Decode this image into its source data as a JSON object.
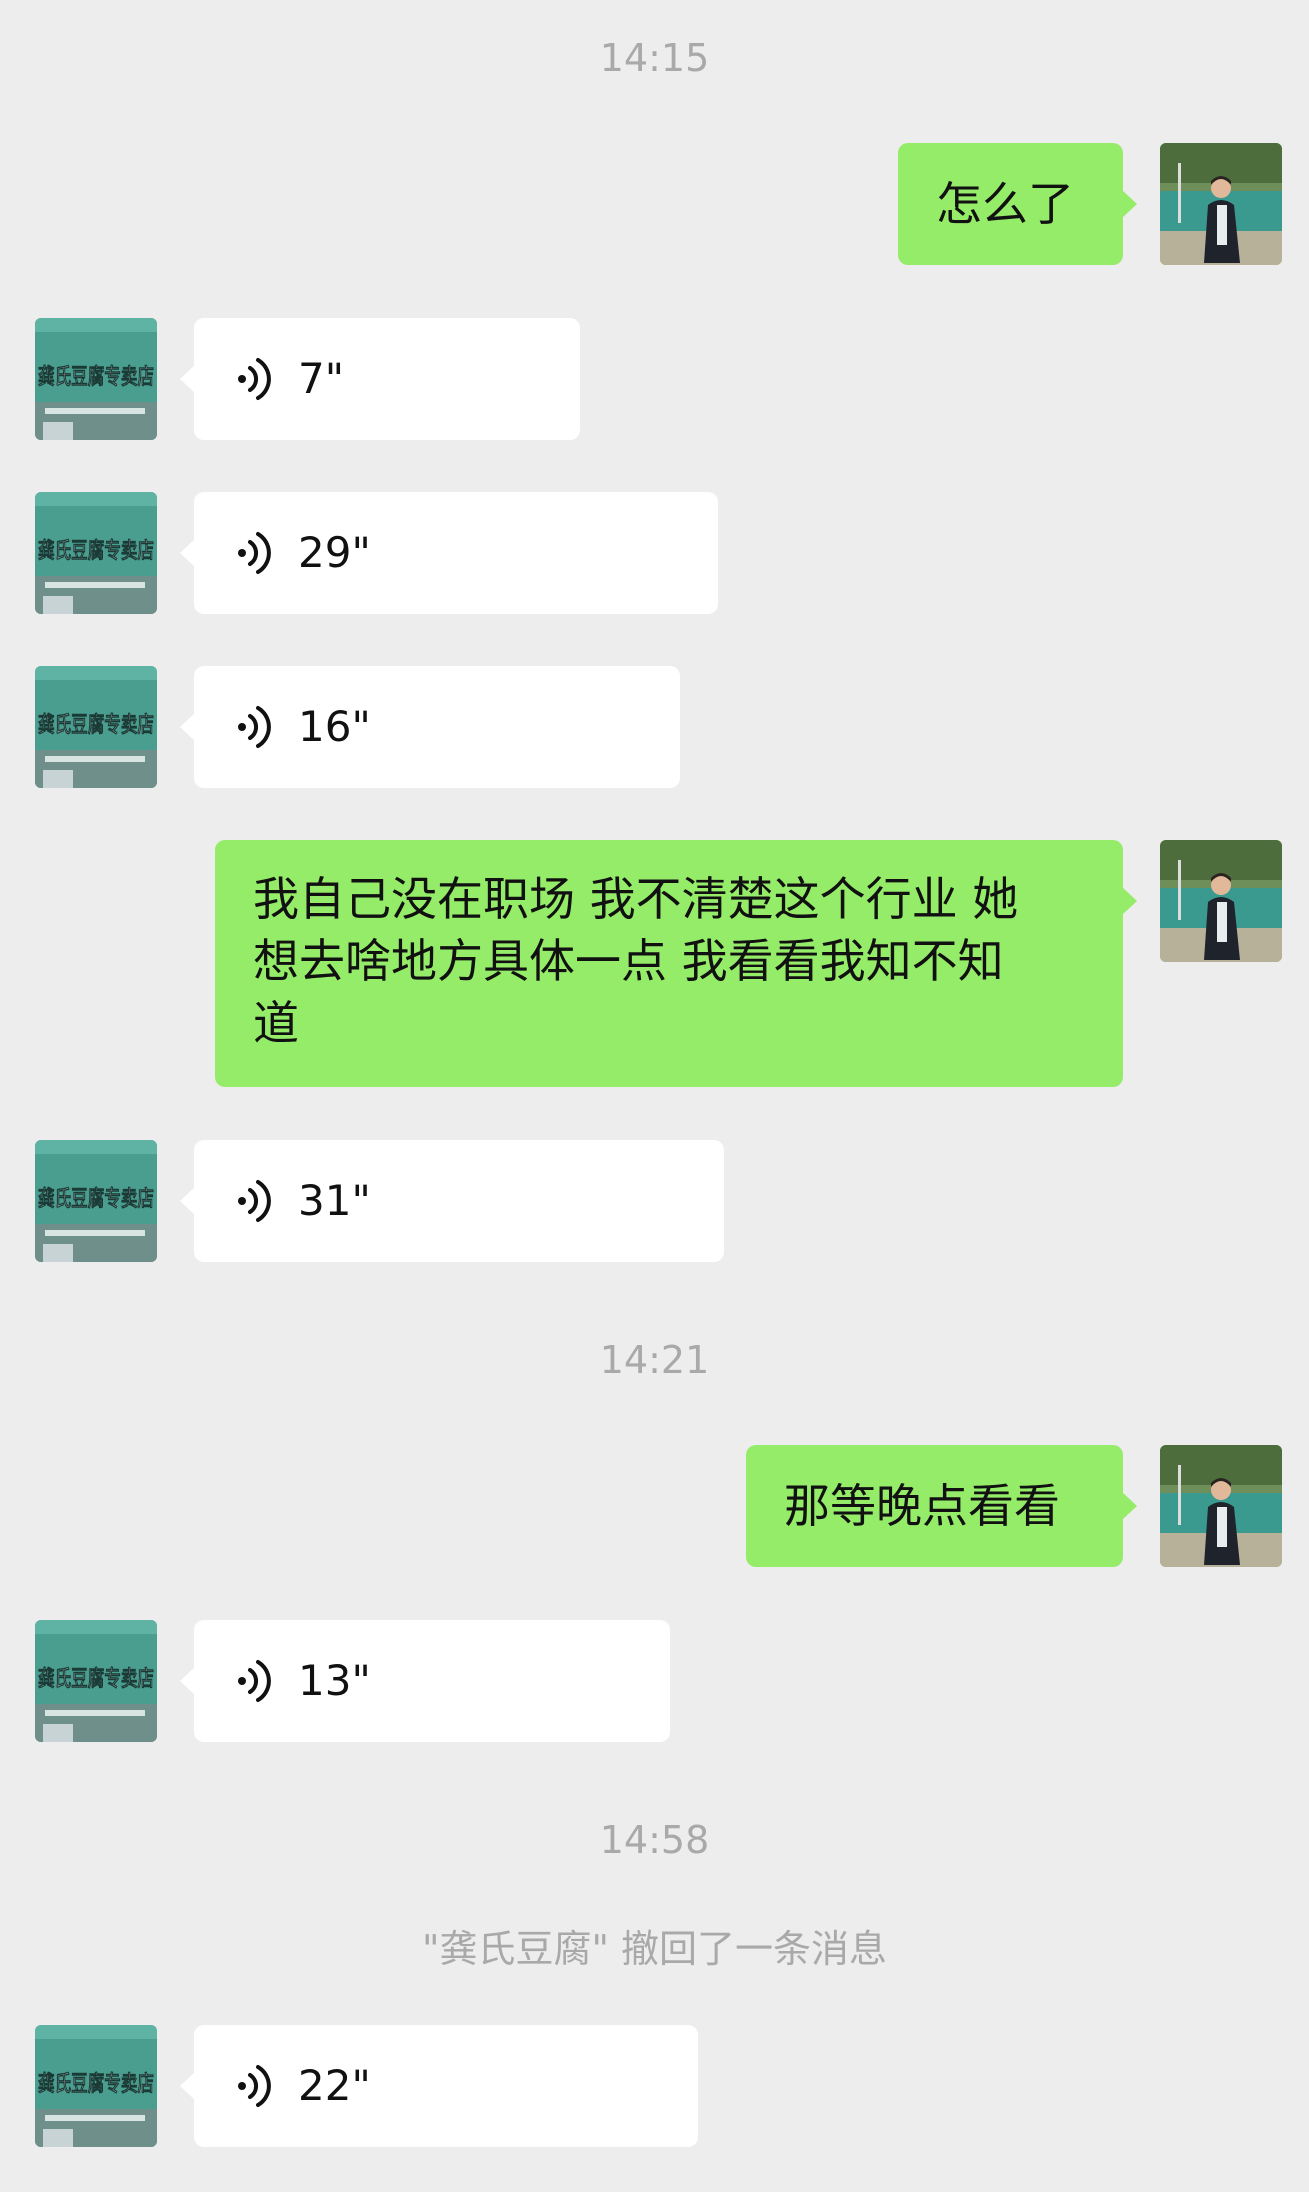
{
  "colors": {
    "background": "#ededed",
    "my_bubble": "#95ec69",
    "peer_bubble": "#ffffff",
    "meta_text": "#a9a9a9"
  },
  "peer_avatar_sign": "龚氏豆腐专卖店",
  "messages": [
    {
      "kind": "time",
      "text": "14:15"
    },
    {
      "kind": "text",
      "from": "me",
      "text": "怎么了"
    },
    {
      "kind": "voice",
      "from": "peer",
      "duration": "7\"",
      "icon": "voice-wave-icon"
    },
    {
      "kind": "voice",
      "from": "peer",
      "duration": "29\"",
      "icon": "voice-wave-icon"
    },
    {
      "kind": "voice",
      "from": "peer",
      "duration": "16\"",
      "icon": "voice-wave-icon"
    },
    {
      "kind": "text",
      "from": "me",
      "lines": [
        "我自己没在职场 我不清楚这个行业 她",
        "想去啥地方具体一点 我看看我知不知",
        "道"
      ]
    },
    {
      "kind": "voice",
      "from": "peer",
      "duration": "31\"",
      "icon": "voice-wave-icon"
    },
    {
      "kind": "time",
      "text": "14:21"
    },
    {
      "kind": "text",
      "from": "me",
      "text": "那等晚点看看"
    },
    {
      "kind": "voice",
      "from": "peer",
      "duration": "13\"",
      "icon": "voice-wave-icon"
    },
    {
      "kind": "time",
      "text": "14:58"
    },
    {
      "kind": "system",
      "text": "\"龚氏豆腐\" 撤回了一条消息"
    },
    {
      "kind": "voice",
      "from": "peer",
      "duration": "22\"",
      "icon": "voice-wave-icon"
    }
  ]
}
